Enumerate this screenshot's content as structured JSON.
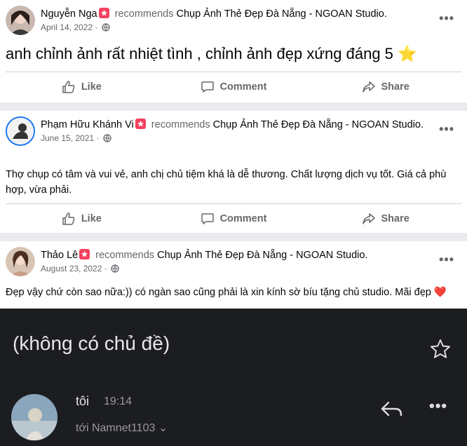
{
  "reviews": [
    {
      "author": "Nguyễn Nga",
      "recommends": "recommends",
      "page": "Chụp Ảnh Thẻ Đẹp Đà Nẵng - NGOAN Studio",
      "date": "April 14, 2022",
      "text": "anh chỉnh ảnh rất nhiệt tình , chỉnh ảnh đẹp xứng đáng 5 ⭐"
    },
    {
      "author": "Phạm Hữu Khánh Vi",
      "recommends": "recommends",
      "page": "Chụp Ảnh Thẻ Đẹp Đà Nẵng - NGOAN Studio",
      "date": "June 15, 2021",
      "text": "Thợ chụp có tâm và vui vẻ, anh chị chủ tiệm khá là dễ thương. Chất lượng dịch vụ tốt. Giá cả phù hợp, vừa phải."
    },
    {
      "author": "Thảo Lê",
      "recommends": "recommends",
      "page": "Chụp Ảnh Thẻ Đẹp Đà Nẵng - NGOAN Studio",
      "date": "August 23, 2022",
      "text": "Đẹp vậy chứ còn sao nữa:)) có ngàn sao cũng phải là xin kính sờ bíu tặng chủ studio. Mãi đẹp ❤️"
    }
  ],
  "actions": {
    "like": "Like",
    "comment": "Comment",
    "share": "Share"
  },
  "email": {
    "subject": "(không có chủ đề)",
    "sender": "tôi",
    "time": "19:14",
    "recipients": "tới Namnet1103",
    "chevron": "⌄"
  },
  "colors": {
    "badge": "#f3425f",
    "dark_bg": "#1c1d20",
    "link": "#050505"
  },
  "icons": [
    "globe-icon",
    "like-icon",
    "comment-icon",
    "share-icon",
    "star-icon",
    "reply-icon",
    "more-icon"
  ]
}
